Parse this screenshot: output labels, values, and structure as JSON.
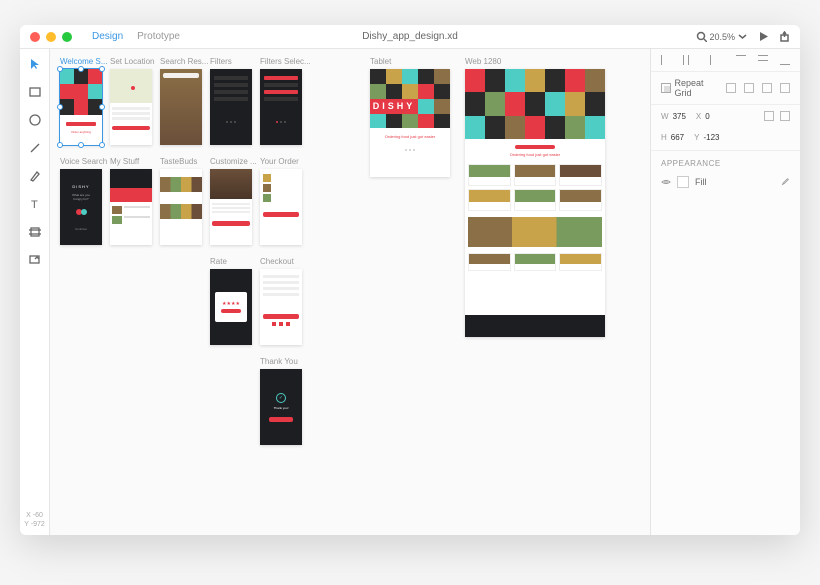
{
  "window": {
    "title": "Dishy_app_design.xd"
  },
  "modes": {
    "design": "Design",
    "prototype": "Prototype"
  },
  "zoom": "20.5%",
  "artboards": {
    "welcome": "Welcome S...",
    "set_location": "Set Location",
    "search": "Search Res...",
    "filters": "Filters",
    "filters_sel": "Filters Selec...",
    "voice": "Voice Search",
    "mystuff": "My Stuff",
    "tastebuds": "TasteBuds",
    "customize": "Customize ...",
    "order": "Your Order",
    "rate": "Rate",
    "checkout": "Checkout",
    "thankyou": "Thank You",
    "tablet": "Tablet",
    "web": "Web 1280"
  },
  "brand": "DISHY",
  "tablet_tagline": "Ordering food just got easier",
  "web_tagline": "Ordering food just got easier",
  "inspector": {
    "repeat_grid": "Repeat Grid",
    "w": "375",
    "x": "0",
    "h": "667",
    "y": "-123",
    "appearance": "APPEARANCE",
    "fill": "Fill"
  },
  "coords": {
    "x": "X  -60",
    "y": "Y  -972"
  }
}
